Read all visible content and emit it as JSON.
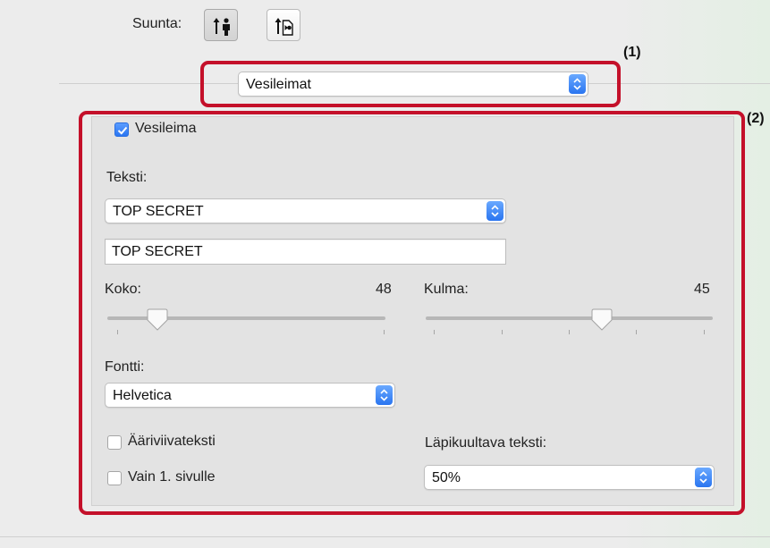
{
  "orientation": {
    "label": "Suunta:",
    "options": [
      {
        "name": "portrait",
        "icon": "portrait-orientation-icon",
        "selected": true
      },
      {
        "name": "landscape",
        "icon": "landscape-orientation-icon",
        "selected": false
      }
    ]
  },
  "panel_menu": {
    "value": "Vesileimat"
  },
  "watermark": {
    "enabled_label": "Vesileima",
    "enabled": true,
    "text_label": "Teksti:",
    "text_preset": "TOP SECRET",
    "text_value": "TOP SECRET",
    "size_label": "Koko:",
    "size_value": "48",
    "angle_label": "Kulma:",
    "angle_value": "45",
    "font_label": "Fontti:",
    "font_value": "Helvetica",
    "outline_label": "Ääriviivateksti",
    "outline_checked": false,
    "first_page_label": "Vain 1. sivulle",
    "first_page_checked": false,
    "transparency_label": "Läpikuultava teksti:",
    "transparency_value": "50%"
  },
  "callouts": {
    "one": "(1)",
    "two": "(2)"
  },
  "colors": {
    "callout": "#c4102a",
    "accent": "#2a75f0"
  }
}
